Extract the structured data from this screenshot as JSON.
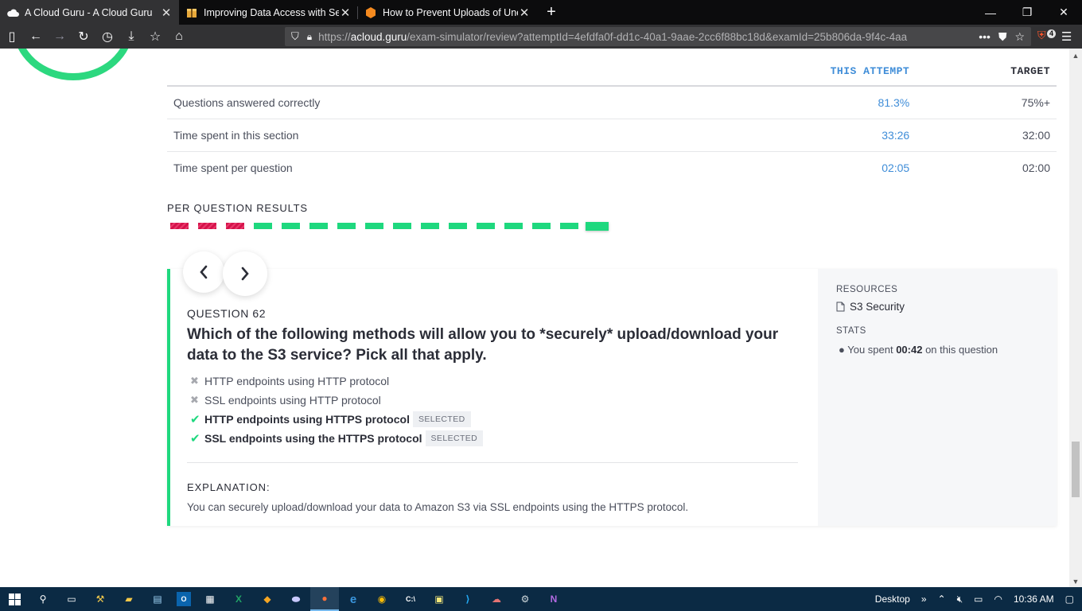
{
  "browser": {
    "tabs": [
      {
        "title": "A Cloud Guru - A Cloud Guru",
        "active": true
      },
      {
        "title": "Improving Data Access with Se",
        "active": false
      },
      {
        "title": "How to Prevent Uploads of Une",
        "active": false
      }
    ],
    "url_prefix": "https://",
    "url_host": "acloud.guru",
    "url_path": "/exam-simulator/review?attemptId=4efdfa0f-dd1c-40a1-9aae-2cc6f88bc18d&examId=25b806da-9f4c-4aa",
    "ext_badge": "4"
  },
  "stats": {
    "header_attempt": "THIS ATTEMPT",
    "header_target": "TARGET",
    "rows": [
      {
        "label": "Questions answered correctly",
        "attempt": "81.3%",
        "target": "75%+"
      },
      {
        "label": "Time spent in this section",
        "attempt": "33:26",
        "target": "32:00"
      },
      {
        "label": "Time spent per question",
        "attempt": "02:05",
        "target": "02:00"
      }
    ]
  },
  "per_question": {
    "label": "PER QUESTION RESULTS",
    "results": [
      "wrong",
      "wrong",
      "wrong",
      "right",
      "right",
      "right",
      "right",
      "right",
      "right",
      "right",
      "right",
      "right",
      "right",
      "right",
      "right",
      "right"
    ],
    "current_index": 15
  },
  "question": {
    "number_label": "QUESTION 62",
    "text": "Which of the following methods will allow you to *securely* upload/download your data to the S3 service? Pick all that apply.",
    "answers": [
      {
        "text": "HTTP endpoints using HTTP protocol",
        "correct": false,
        "selected": false
      },
      {
        "text": "SSL endpoints using HTTP protocol",
        "correct": false,
        "selected": false
      },
      {
        "text": "HTTP endpoints using HTTPS protocol",
        "correct": true,
        "selected": true
      },
      {
        "text": "SSL endpoints using the HTTPS protocol",
        "correct": true,
        "selected": true
      }
    ],
    "selected_badge": "SELECTED",
    "explanation_label": "EXPLANATION:",
    "explanation": "You can securely upload/download your data to Amazon S3 via SSL endpoints using the HTTPS protocol."
  },
  "sidebar": {
    "resources_label": "RESOURCES",
    "resource_link": "S3 Security",
    "stats_label": "STATS",
    "stat_prefix": "You spent ",
    "stat_value": "00:42",
    "stat_suffix": " on this question"
  },
  "taskbar": {
    "desktop_label": "Desktop",
    "time": "10:36 AM"
  },
  "colors": {
    "accent_green": "#1ed87e",
    "accent_blue": "#3f8dd8",
    "wrong_red": "#d5124a"
  }
}
